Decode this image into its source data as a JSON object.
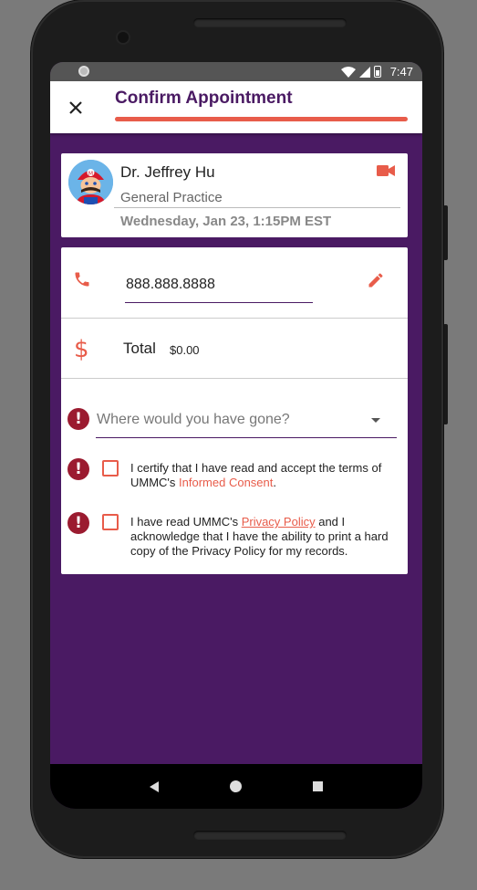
{
  "statusbar": {
    "time": "7:47"
  },
  "appbar": {
    "title": "Confirm Appointment",
    "close_icon": "close-icon",
    "accent_color": "#e85c4a"
  },
  "doctor": {
    "name": "Dr. Jeffrey Hu",
    "specialty": "General Practice",
    "appointment": "Wednesday, Jan 23, 1:15PM EST",
    "video_icon": "video-camera-icon"
  },
  "contact": {
    "phone": "888.888.8888",
    "phone_icon": "phone-icon",
    "edit_icon": "pencil-icon"
  },
  "payment": {
    "label": "Total",
    "amount": "$0.00",
    "icon": "dollar-icon"
  },
  "location": {
    "placeholder": "Where would you have gone?",
    "alert_icon": "alert-icon"
  },
  "consents": {
    "informed": {
      "prefix": "I certify that I have read and accept the terms of UMMC's ",
      "link": "Informed Consent",
      "suffix": ".",
      "checked": false
    },
    "privacy": {
      "prefix": "I have read UMMC's ",
      "link": "Privacy Policy",
      "suffix": " and I acknowledge that I have the ability to print a hard copy of the Privacy Policy for my records.",
      "checked": false
    }
  },
  "colors": {
    "primary": "#4a1a63",
    "accent": "#e85c4a",
    "alert": "#9b1b30"
  }
}
